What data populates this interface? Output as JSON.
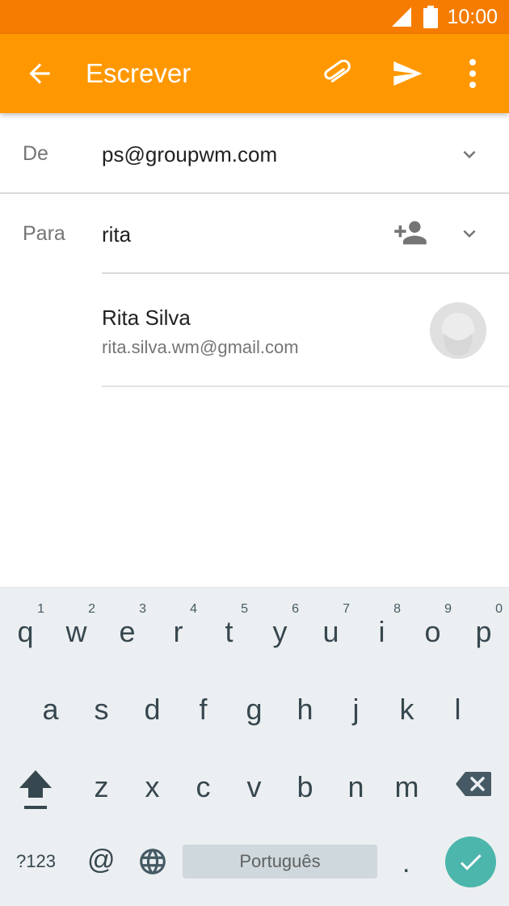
{
  "status": {
    "time": "10:00"
  },
  "appbar": {
    "title": "Escrever",
    "icons": [
      "back-arrow-icon",
      "paperclip-icon",
      "send-icon",
      "more-vert-icon"
    ],
    "color": "#FF9800",
    "status_color": "#F57C00"
  },
  "from": {
    "label": "De",
    "value": "ps@groupwm.com"
  },
  "to": {
    "label": "Para",
    "value": "rita"
  },
  "suggestion": {
    "name": "Rita Silva",
    "email": "rita.silva.wm@gmail.com"
  },
  "keyboard": {
    "row1": [
      {
        "ch": "q",
        "num": "1"
      },
      {
        "ch": "w",
        "num": "2"
      },
      {
        "ch": "e",
        "num": "3"
      },
      {
        "ch": "r",
        "num": "4"
      },
      {
        "ch": "t",
        "num": "5"
      },
      {
        "ch": "y",
        "num": "6"
      },
      {
        "ch": "u",
        "num": "7"
      },
      {
        "ch": "i",
        "num": "8"
      },
      {
        "ch": "o",
        "num": "9"
      },
      {
        "ch": "p",
        "num": "0"
      }
    ],
    "row2": [
      "a",
      "s",
      "d",
      "f",
      "g",
      "h",
      "j",
      "k",
      "l"
    ],
    "row3": [
      "z",
      "x",
      "c",
      "v",
      "b",
      "n",
      "m"
    ],
    "symbols_label": "?123",
    "at_label": "@",
    "space_label": "Português",
    "period_label": ".",
    "enter_color": "#4DB6AC"
  }
}
